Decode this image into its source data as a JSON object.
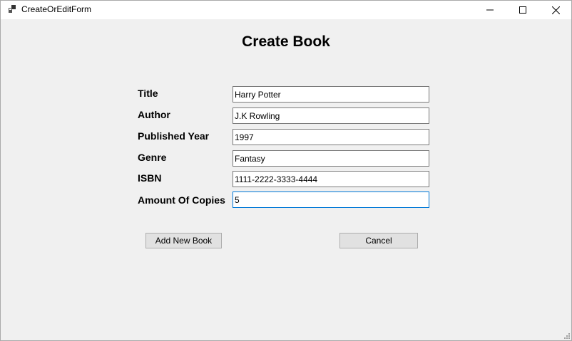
{
  "window": {
    "title": "CreateOrEditForm",
    "icons": {
      "app": "app-form-icon",
      "minimize": "minimize-icon",
      "maximize": "maximize-icon",
      "close": "close-icon"
    }
  },
  "form": {
    "heading": "Create Book",
    "fields": {
      "title": {
        "label": "Title",
        "value": "Harry Potter"
      },
      "author": {
        "label": "Author",
        "value": "J.K Rowling"
      },
      "published_year": {
        "label": "Published Year",
        "value": "1997"
      },
      "genre": {
        "label": "Genre",
        "value": "Fantasy"
      },
      "isbn": {
        "label": "ISBN",
        "value": "1111-2222-3333-4444"
      },
      "amount_of_copies": {
        "label": "Amount Of Copies",
        "value": "5"
      }
    },
    "buttons": {
      "add_label": "Add New Book",
      "cancel_label": "Cancel"
    }
  },
  "colors": {
    "window_background": "#f0f0f0",
    "titlebar_background": "#ffffff",
    "focus_border": "#0078d7",
    "button_background": "#e1e1e1"
  }
}
